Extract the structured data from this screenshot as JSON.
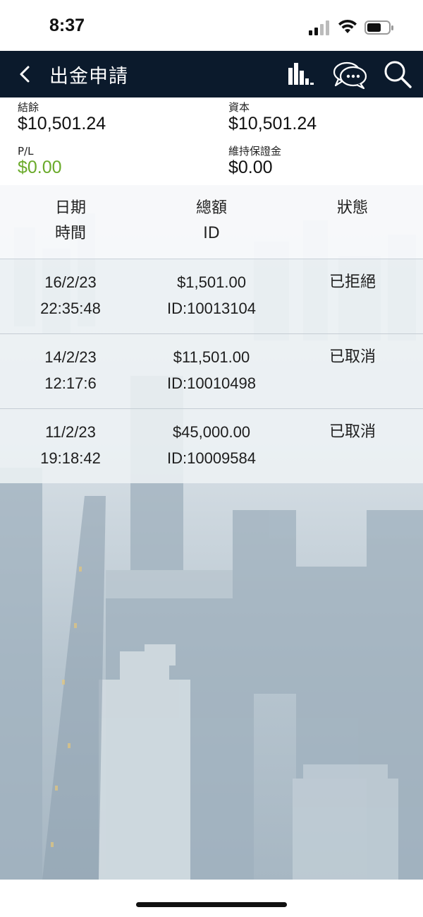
{
  "status_bar": {
    "time": "8:37"
  },
  "nav": {
    "title": "出金申請"
  },
  "summary": {
    "balance_label": "結餘",
    "balance_value": "$10,501.24",
    "equity_label": "資本",
    "equity_value": "$10,501.24",
    "pl_label": "P/L",
    "pl_value": "$0.00",
    "margin_label": "維持保證金",
    "margin_value": "$0.00"
  },
  "table": {
    "headers": {
      "date": "日期",
      "time": "時間",
      "amount": "總額",
      "id": "ID",
      "status": "狀態"
    },
    "rows": [
      {
        "date": "16/2/23",
        "time": "22:35:48",
        "amount": "$1,501.00",
        "id": "ID:10013104",
        "status": "已拒絕"
      },
      {
        "date": "14/2/23",
        "time": "12:17:6",
        "amount": "$11,501.00",
        "id": "ID:10010498",
        "status": "已取消"
      },
      {
        "date": "11/2/23",
        "time": "19:18:42",
        "amount": "$45,000.00",
        "id": "ID:10009584",
        "status": "已取消"
      }
    ]
  },
  "colors": {
    "nav_bg": "#0b1a2c",
    "pl_green": "#6aaa2a"
  },
  "icons": [
    "back-chevron-icon",
    "bar-chart-icon",
    "chat-bubbles-icon",
    "search-icon",
    "cellular-signal-icon",
    "wifi-icon",
    "battery-icon"
  ]
}
